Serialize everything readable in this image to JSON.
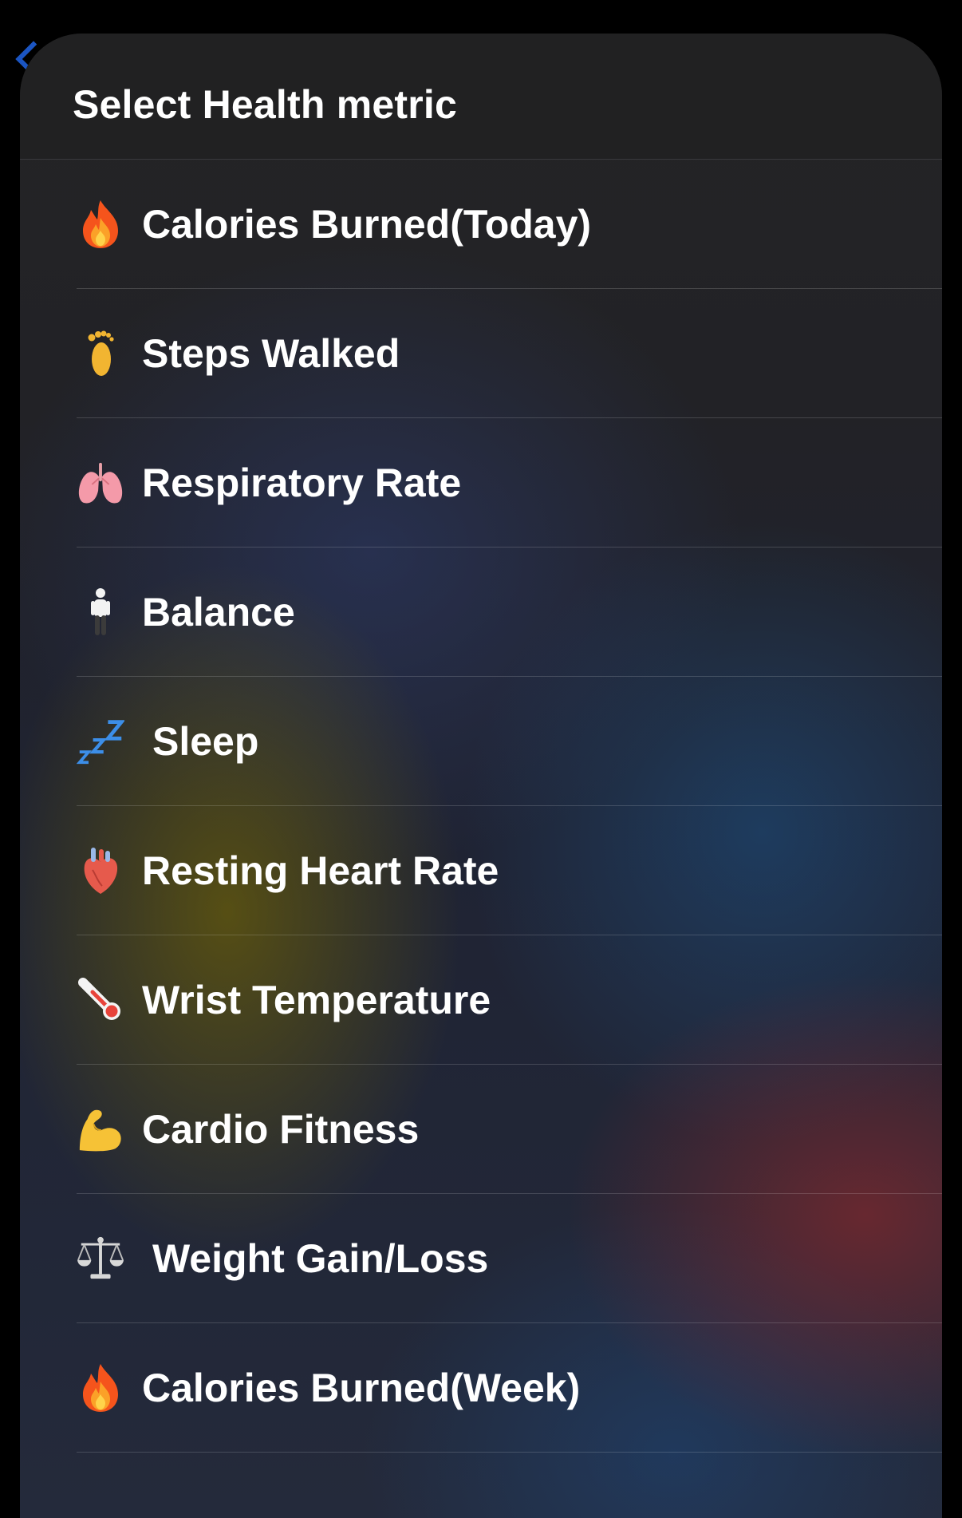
{
  "header": {
    "title": "Select Health metric"
  },
  "metrics": [
    {
      "label": "Calories Burned(Today)",
      "icon": "fire-icon"
    },
    {
      "label": "Steps Walked",
      "icon": "footprint-icon"
    },
    {
      "label": "Respiratory Rate",
      "icon": "lungs-icon"
    },
    {
      "label": "Balance",
      "icon": "standing-person-icon"
    },
    {
      "label": "Sleep",
      "icon": "zzz-icon"
    },
    {
      "label": "Resting Heart Rate",
      "icon": "anatomical-heart-icon"
    },
    {
      "label": "Wrist Temperature",
      "icon": "thermometer-icon"
    },
    {
      "label": "Cardio Fitness",
      "icon": "flexed-biceps-icon"
    },
    {
      "label": "Weight Gain/Loss",
      "icon": "balance-scale-icon"
    },
    {
      "label": "Calories Burned(Week)",
      "icon": "fire-icon"
    }
  ],
  "colors": {
    "background": "#000000",
    "sheet_header": "#212122",
    "text": "#ffffff",
    "accent_back": "#1f5fd8"
  }
}
